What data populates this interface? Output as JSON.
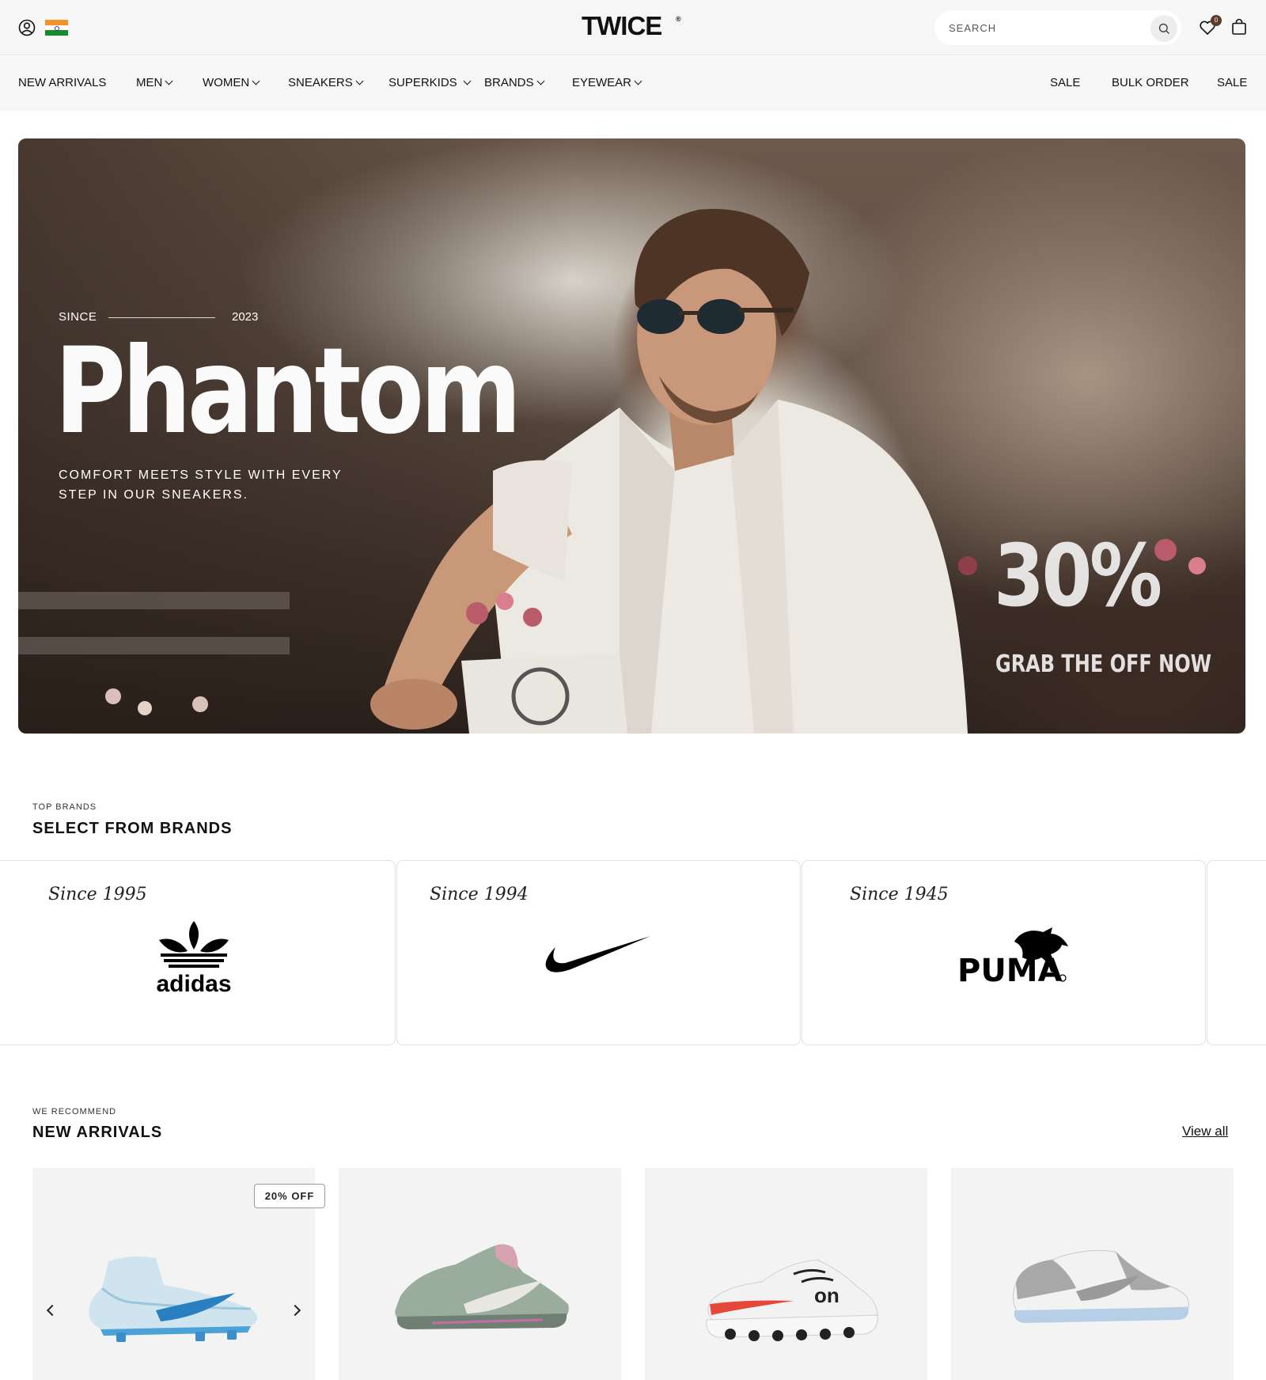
{
  "header": {
    "logo": "TWICE",
    "logo_mark": "®",
    "search_placeholder": "SEARCH",
    "wishlist_count": "0",
    "icons": [
      "user-icon",
      "india-flag-icon",
      "search-icon",
      "heart-icon",
      "bag-icon"
    ]
  },
  "nav": {
    "left": [
      {
        "label": "NEW ARRIVALS",
        "dropdown": false
      },
      {
        "label": "MEN",
        "dropdown": true
      },
      {
        "label": "WOMEN",
        "dropdown": true
      },
      {
        "label": "SNEAKERS",
        "dropdown": true
      },
      {
        "label": "SUPERKIDS",
        "dropdown": true
      },
      {
        "label": "BRANDS",
        "dropdown": true
      },
      {
        "label": "EYEWEAR",
        "dropdown": true
      }
    ],
    "right": [
      {
        "label": "SALE"
      },
      {
        "label": "BULK ORDER"
      },
      {
        "label": "SALE"
      }
    ]
  },
  "hero": {
    "since_label": "SINCE",
    "since_year": "2023",
    "title": "Phantom",
    "subtitle_line1": "COMFORT MEETS STYLE WITH EVERY",
    "subtitle_line2": "STEP IN OUR SNEAKERS.",
    "discount": "30%",
    "cta": "GRAB THE OFF NOW"
  },
  "brands": {
    "kicker": "TOP BRANDS",
    "title": "SELECT FROM BRANDS",
    "items": [
      {
        "since": "Since 1995",
        "name": "adidas",
        "logo_icon": "adidas-trefoil-logo"
      },
      {
        "since": "Since 1994",
        "name": "Nike",
        "logo_icon": "nike-swoosh-logo"
      },
      {
        "since": "Since 1945",
        "name": "PUMA",
        "logo_icon": "puma-cat-logo"
      }
    ]
  },
  "arrivals": {
    "kicker": "WE RECOMMEND",
    "title": "NEW ARRIVALS",
    "view_all": "View all",
    "products": [
      {
        "badge": "20% OFF",
        "image": "light-blue-football-boot",
        "colors": [
          "#cfe4ee",
          "#2a7fc1"
        ]
      },
      {
        "badge": "",
        "image": "sage-green-running-shoe",
        "colors": [
          "#9aad9c",
          "#d8a3b1"
        ]
      },
      {
        "badge": "",
        "image": "white-red-on-running-shoe",
        "colors": [
          "#f2f2f2",
          "#e5483a"
        ]
      },
      {
        "badge": "",
        "image": "grey-low-sneaker",
        "colors": [
          "#a8a8a8",
          "#f2f2f2"
        ]
      }
    ]
  }
}
